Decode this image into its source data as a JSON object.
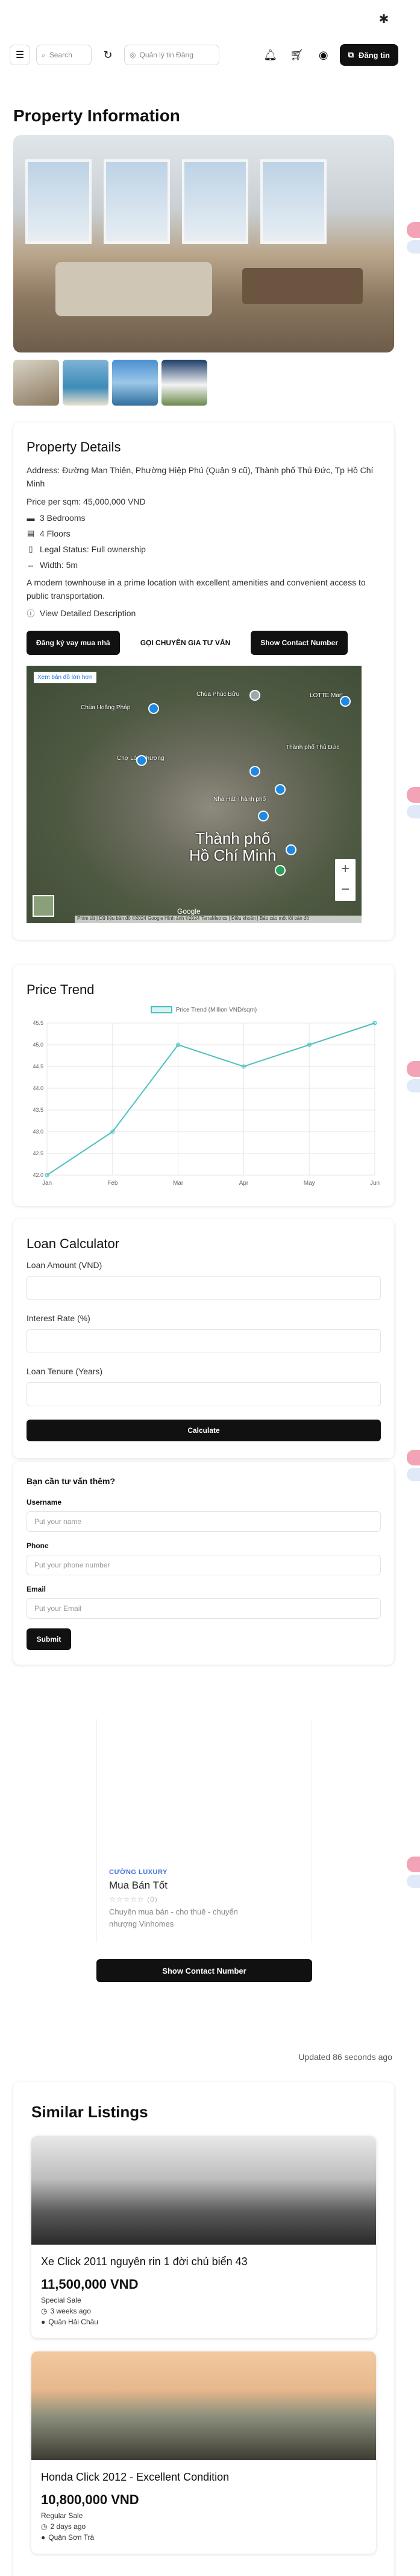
{
  "header": {
    "search_placeholder": "Search",
    "location_placeholder": "Quản lý tin Đăng",
    "post_button": "Đăng tin"
  },
  "page_title": "Property Information",
  "details": {
    "heading": "Property Details",
    "address": "Address: Đường Man Thiện, Phường Hiệp Phú (Quận 9 cũ), Thành phố Thủ Đức, Tp Hồ Chí Minh",
    "price": "Price per sqm: 45,000,000 VND",
    "bedrooms": "3 Bedrooms",
    "floors": "4 Floors",
    "legal": "Legal Status: Full ownership",
    "width": "Width: 5m",
    "description": "A modern townhouse in a prime location with excellent amenities and convenient access to public transportation.",
    "view_detailed": "View Detailed Description",
    "btn_loan": "Đăng ký vay mua nhà",
    "btn_consult": "GỌI CHUYÊN GIA TƯ VẤN",
    "btn_contact": "Show Contact Number"
  },
  "map": {
    "badge": "Xem bản đồ lớn hơn",
    "city": "Thành phố Hồ Chí Minh",
    "city_line1": "Thành phố",
    "city_line2": "Hồ Chí Minh",
    "google": "Google",
    "attribution": "Phím tắt | Dữ liệu bản đồ ©2024 Google Hình ảnh ©2024 TerraMetrics | Điều khoản | Báo cáo một lỗi bản đồ",
    "labels": [
      "Chùa Hoằng Pháp",
      "Chùa Phúc Bửu",
      "Chợ Lớn Thượng",
      "Thành phố Thủ Đức",
      "Nhà Hát Thành phố",
      "LOTTE Mart"
    ]
  },
  "chart_data": {
    "type": "line",
    "title": "Price Trend",
    "categories": [
      "Jan",
      "Feb",
      "Mar",
      "Apr",
      "May",
      "Jun"
    ],
    "series": [
      {
        "name": "Price Trend (Million VND/sqm)",
        "values": [
          42.0,
          43.0,
          45.0,
          44.5,
          45.0,
          45.5
        ]
      }
    ],
    "ylim": [
      42.0,
      45.5
    ],
    "yticks": [
      "42.0",
      "42.5",
      "43.0",
      "43.5",
      "44.0",
      "44.5",
      "45.0",
      "45.5"
    ],
    "grid": true,
    "legend_position": "top",
    "color": "#4bc0c0"
  },
  "loan": {
    "heading": "Loan Calculator",
    "amount_label": "Loan Amount (VND)",
    "rate_label": "Interest Rate (%)",
    "tenure_label": "Loan Tenure (Years)",
    "calculate": "Calculate"
  },
  "consult": {
    "heading": "Bạn cần tư vấn thêm?",
    "username_label": "Username",
    "username_placeholder": "Put your name",
    "phone_label": "Phone",
    "phone_placeholder": "Put your phone number",
    "email_label": "Email",
    "email_placeholder": "Put your Email",
    "submit": "Submit"
  },
  "agent": {
    "tag": "CƯỜNG LUXURY",
    "name": "Mua Bán Tốt",
    "stars": "☆☆☆☆☆ (0)",
    "description": "Chuyên mua bán - cho thuê - chuyển nhượng Vinhomes",
    "contact_button": "Show Contact Number"
  },
  "updated": "Updated 86 seconds ago",
  "similar": {
    "heading": "Similar Listings",
    "items": [
      {
        "title": "Xe Click 2011 nguyên rin 1 đời chủ biển 43",
        "price": "11,500,000 VND",
        "type": "Special Sale",
        "time": "3 weeks ago",
        "location": "Quận Hải Châu"
      },
      {
        "title": "Honda Click 2012 - Excellent Condition",
        "price": "10,800,000 VND",
        "type": "Regular Sale",
        "time": "2 days ago",
        "location": "Quận Sơn Trà"
      }
    ]
  }
}
